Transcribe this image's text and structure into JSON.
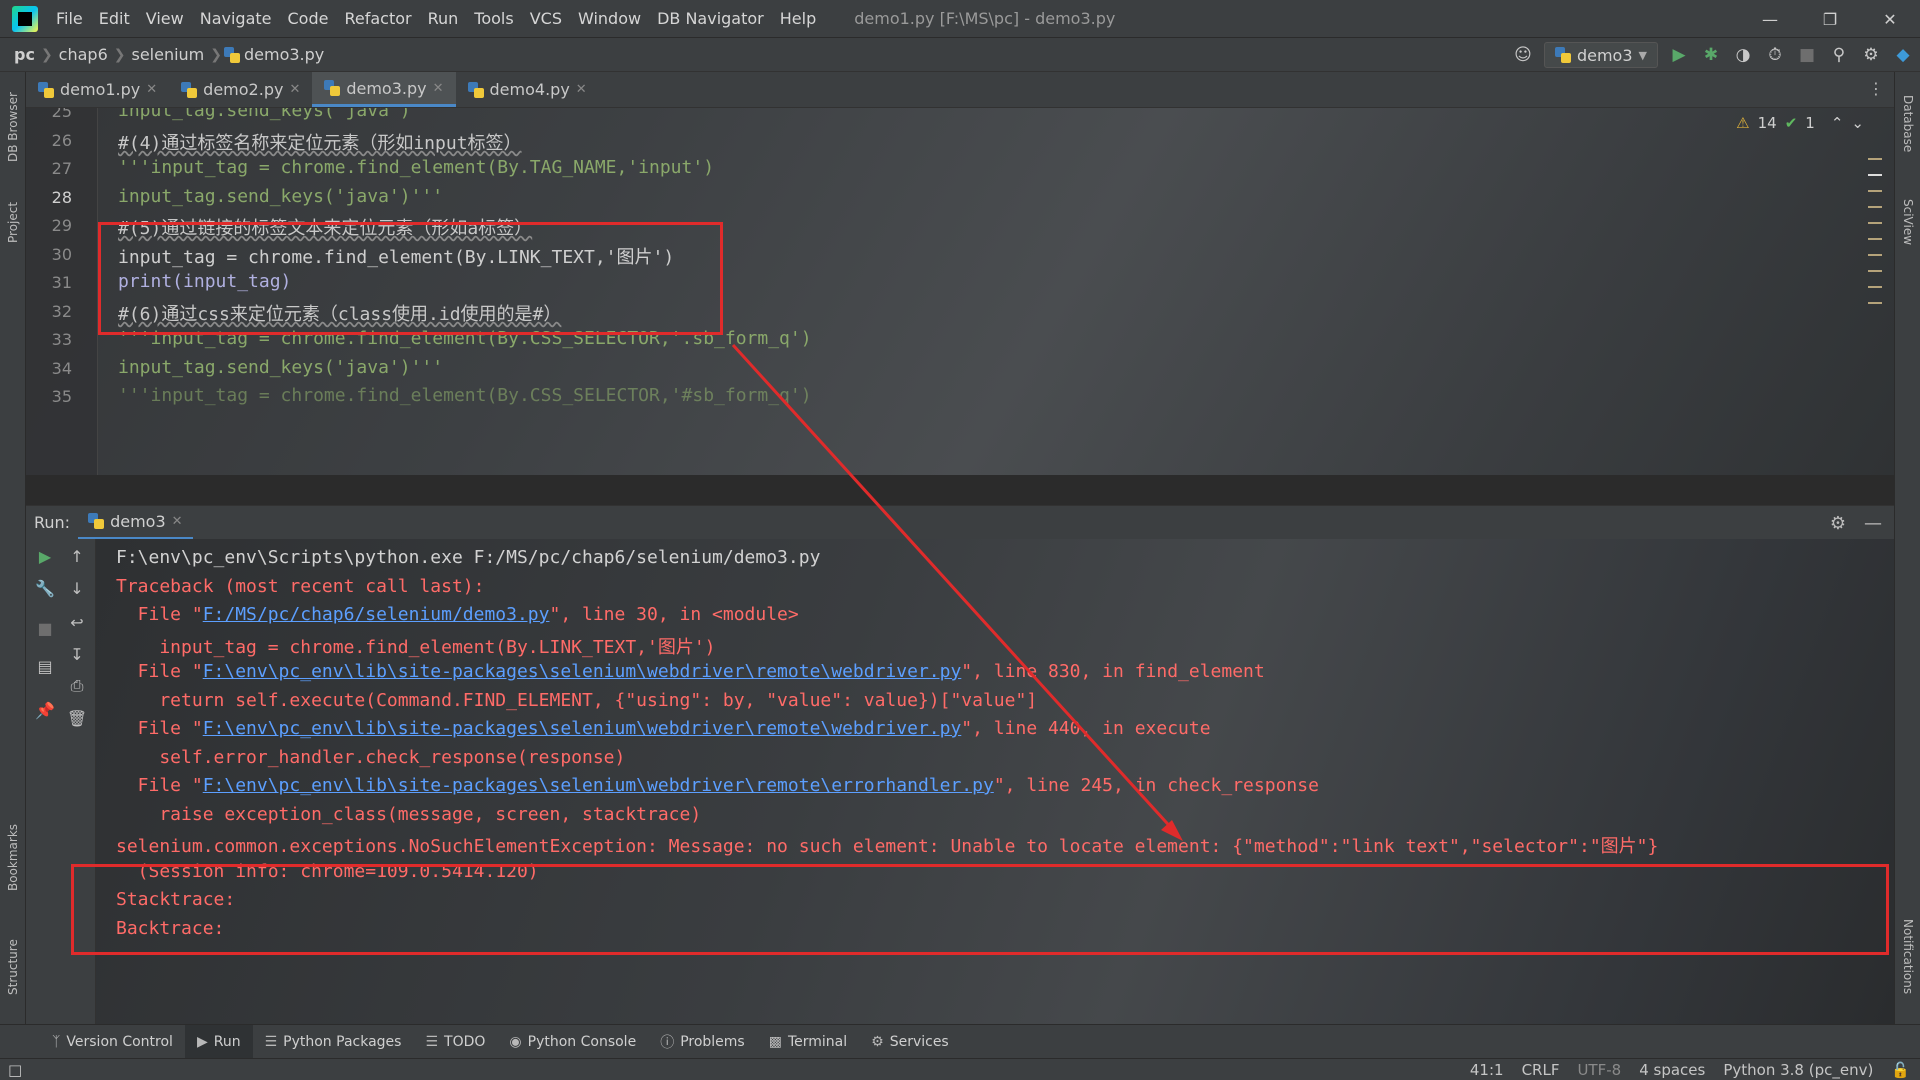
{
  "window": {
    "title": "demo1.py [F:\\MS\\pc] - demo3.py",
    "menu": [
      "File",
      "Edit",
      "View",
      "Navigate",
      "Code",
      "Refactor",
      "Run",
      "Tools",
      "VCS",
      "Window",
      "DB Navigator",
      "Help"
    ]
  },
  "breadcrumb": [
    "pc",
    "chap6",
    "selenium",
    "demo3.py"
  ],
  "run_config": "demo3",
  "left_tool_tabs": [
    "DB Browser",
    "Project",
    "Bookmarks",
    "Structure"
  ],
  "right_tool_tabs": [
    "Database",
    "SciView",
    "Notifications"
  ],
  "editor_tabs": [
    {
      "label": "demo1.py",
      "active": false
    },
    {
      "label": "demo2.py",
      "active": false
    },
    {
      "label": "demo3.py",
      "active": true
    },
    {
      "label": "demo4.py",
      "active": false
    }
  ],
  "inspection": {
    "warnings": "14",
    "ok": "1"
  },
  "editor": {
    "lines": [
      {
        "num": "25",
        "text": "input_tag.send_keys('java')'''"
      },
      {
        "num": "26",
        "text": "#(4)通过标签名称来定位元素（形如input标签）"
      },
      {
        "num": "27",
        "text": "'''input_tag = chrome.find_element(By.TAG_NAME,'input')"
      },
      {
        "num": "28",
        "text": "input_tag.send_keys('java')'''"
      },
      {
        "num": "29",
        "text": "#(5)通过链接的标签文本来定位元素（形如a标签）"
      },
      {
        "num": "30",
        "text": "input_tag = chrome.find_element(By.LINK_TEXT,'图片')"
      },
      {
        "num": "31",
        "text": "print(input_tag)"
      },
      {
        "num": "32",
        "text": "#(6)通过css来定位元素（class使用.id使用的是#）"
      },
      {
        "num": "33",
        "text": "'''input_tag = chrome.find_element(By.CSS_SELECTOR,'.sb_form_q')"
      },
      {
        "num": "34",
        "text": "input_tag.send_keys('java')'''"
      },
      {
        "num": "35",
        "text": "'''input_tag = chrome.find_element(By.CSS_SELECTOR,'#sb_form_q')"
      }
    ]
  },
  "run": {
    "label": "Run:",
    "tab": "demo3",
    "console": [
      {
        "text": "F:\\env\\pc_env\\Scripts\\python.exe F:/MS/pc/chap6/selenium/demo3.py"
      },
      {
        "text": "Traceback (most recent call last):"
      },
      {
        "pre": "  File \"",
        "link": "F:/MS/pc/chap6/selenium/demo3.py",
        "post": "\", line 30, in <module>"
      },
      {
        "text": "    input_tag = chrome.find_element(By.LINK_TEXT,'图片')"
      },
      {
        "pre": "  File \"",
        "link": "F:\\env\\pc_env\\lib\\site-packages\\selenium\\webdriver\\remote\\webdriver.py",
        "post": "\", line 830, in find_element"
      },
      {
        "text": "    return self.execute(Command.FIND_ELEMENT, {\"using\": by, \"value\": value})[\"value\"]"
      },
      {
        "pre": "  File \"",
        "link": "F:\\env\\pc_env\\lib\\site-packages\\selenium\\webdriver\\remote\\webdriver.py",
        "post": "\", line 440, in execute"
      },
      {
        "text": "    self.error_handler.check_response(response)"
      },
      {
        "pre": "  File \"",
        "link": "F:\\env\\pc_env\\lib\\site-packages\\selenium\\webdriver\\remote\\errorhandler.py",
        "post": "\", line 245, in check_response"
      },
      {
        "text": "    raise exception_class(message, screen, stacktrace)"
      },
      {
        "text": "selenium.common.exceptions.NoSuchElementException: Message: no such element: Unable to locate element: {\"method\":\"link text\",\"selector\":\"图片\"}"
      },
      {
        "text": "  (Session info: chrome=109.0.5414.120)"
      },
      {
        "text": "Stacktrace:"
      },
      {
        "text": "Backtrace:"
      }
    ]
  },
  "bottom_tabs": [
    {
      "label": "Version Control",
      "icon": "branch-icon"
    },
    {
      "label": "Run",
      "icon": "play-icon"
    },
    {
      "label": "Python Packages",
      "icon": "packages-icon"
    },
    {
      "label": "TODO",
      "icon": "list-icon"
    },
    {
      "label": "Python Console",
      "icon": "python-console-icon"
    },
    {
      "label": "Problems",
      "icon": "info-icon"
    },
    {
      "label": "Terminal",
      "icon": "terminal-icon"
    },
    {
      "label": "Services",
      "icon": "services-icon"
    }
  ],
  "status": {
    "position": "41:1",
    "line_sep": "CRLF",
    "encoding": "UTF-8",
    "indent": "4 spaces",
    "interpreter": "Python 3.8 (pc_env)"
  },
  "colors": {
    "annotation": "#e02b2b",
    "error_text": "#ff6b68",
    "link": "#5c9fff",
    "accent": "#4a88c7"
  }
}
